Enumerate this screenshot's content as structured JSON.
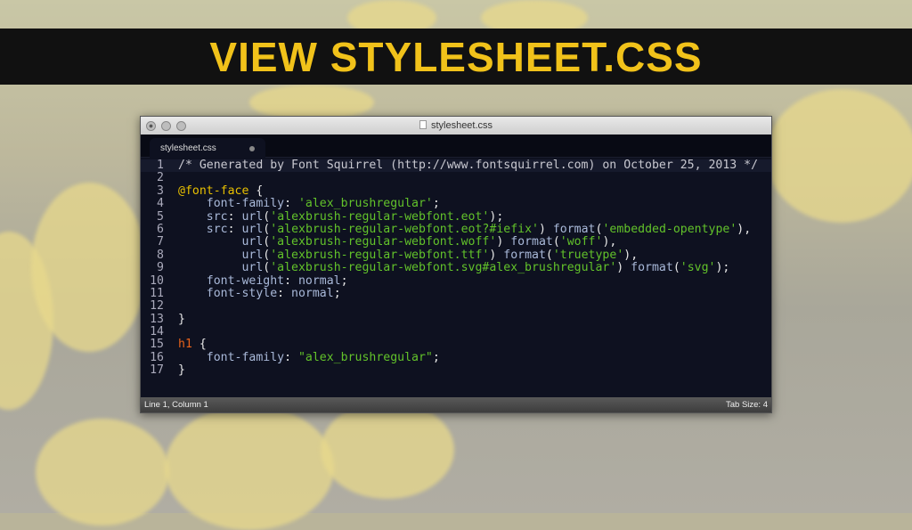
{
  "banner": {
    "title": "VIEW STYLESHEET.CSS"
  },
  "window": {
    "title": "stylesheet.css",
    "tab_label": "stylesheet.css"
  },
  "status": {
    "position": "Line 1, Column 1",
    "tab_size": "Tab Size: 4"
  },
  "code": [
    [
      [
        "com",
        "/* Generated by Font Squirrel (http://www.fontsquirrel.com) on October 25, 2013 */"
      ]
    ],
    [],
    [
      [
        "at",
        "@font-face"
      ],
      [
        "punc",
        " {"
      ]
    ],
    [
      [
        "plain",
        "    font-family"
      ],
      [
        "punc",
        ": "
      ],
      [
        "str",
        "'alex_brushregular'"
      ],
      [
        "punc",
        ";"
      ]
    ],
    [
      [
        "plain",
        "    src"
      ],
      [
        "punc",
        ": "
      ],
      [
        "plain",
        "url"
      ],
      [
        "punc",
        "("
      ],
      [
        "str",
        "'alexbrush-regular-webfont.eot'"
      ],
      [
        "punc",
        ");"
      ]
    ],
    [
      [
        "plain",
        "    src"
      ],
      [
        "punc",
        ": "
      ],
      [
        "plain",
        "url"
      ],
      [
        "punc",
        "("
      ],
      [
        "str",
        "'alexbrush-regular-webfont.eot?#iefix'"
      ],
      [
        "punc",
        ") "
      ],
      [
        "plain",
        "format"
      ],
      [
        "punc",
        "("
      ],
      [
        "str",
        "'embedded-opentype'"
      ],
      [
        "punc",
        "),"
      ]
    ],
    [
      [
        "plain",
        "         url"
      ],
      [
        "punc",
        "("
      ],
      [
        "str",
        "'alexbrush-regular-webfont.woff'"
      ],
      [
        "punc",
        ") "
      ],
      [
        "plain",
        "format"
      ],
      [
        "punc",
        "("
      ],
      [
        "str",
        "'woff'"
      ],
      [
        "punc",
        "),"
      ]
    ],
    [
      [
        "plain",
        "         url"
      ],
      [
        "punc",
        "("
      ],
      [
        "str",
        "'alexbrush-regular-webfont.ttf'"
      ],
      [
        "punc",
        ") "
      ],
      [
        "plain",
        "format"
      ],
      [
        "punc",
        "("
      ],
      [
        "str",
        "'truetype'"
      ],
      [
        "punc",
        "),"
      ]
    ],
    [
      [
        "plain",
        "         url"
      ],
      [
        "punc",
        "("
      ],
      [
        "str",
        "'alexbrush-regular-webfont.svg#alex_brushregular'"
      ],
      [
        "punc",
        ") "
      ],
      [
        "plain",
        "format"
      ],
      [
        "punc",
        "("
      ],
      [
        "str",
        "'svg'"
      ],
      [
        "punc",
        ");"
      ]
    ],
    [
      [
        "plain",
        "    font-weight"
      ],
      [
        "punc",
        ": "
      ],
      [
        "plain",
        "normal"
      ],
      [
        "punc",
        ";"
      ]
    ],
    [
      [
        "plain",
        "    font-style"
      ],
      [
        "punc",
        ": "
      ],
      [
        "plain",
        "normal"
      ],
      [
        "punc",
        ";"
      ]
    ],
    [],
    [
      [
        "punc",
        "}"
      ]
    ],
    [],
    [
      [
        "sel",
        "h1"
      ],
      [
        "punc",
        " {"
      ]
    ],
    [
      [
        "plain",
        "    font-family"
      ],
      [
        "punc",
        ": "
      ],
      [
        "str",
        "\"alex_brushregular\""
      ],
      [
        "punc",
        ";"
      ]
    ],
    [
      [
        "punc",
        "}"
      ]
    ]
  ]
}
